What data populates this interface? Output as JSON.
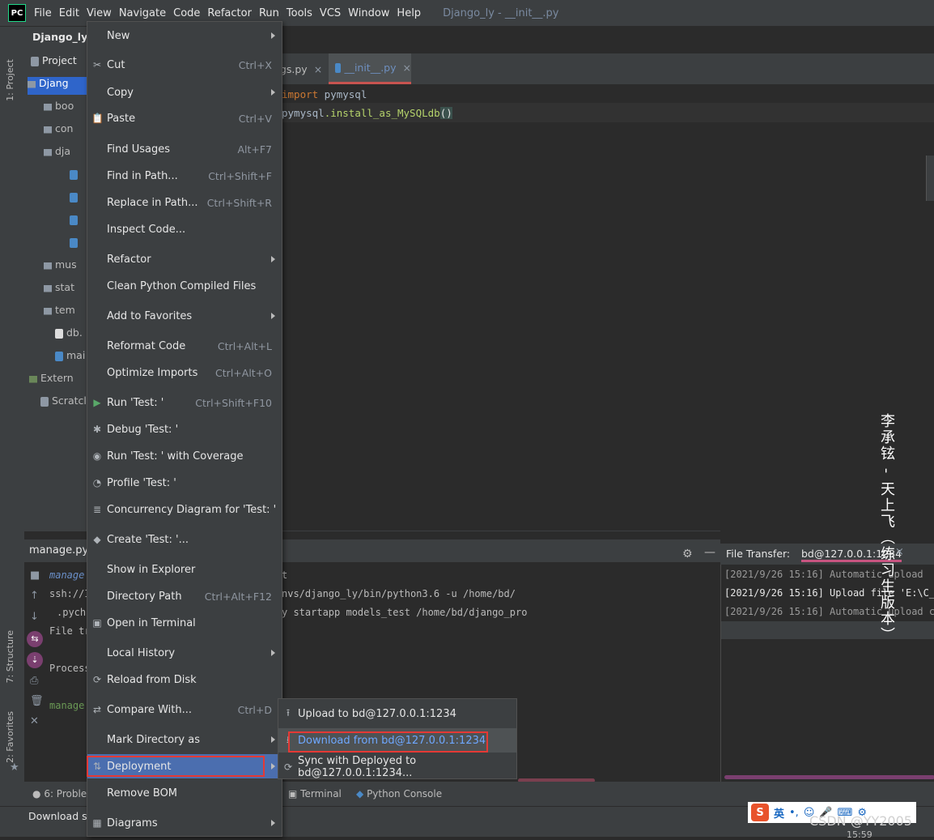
{
  "menubar": {
    "logo": "PC",
    "items": [
      "File",
      "Edit",
      "View",
      "Navigate",
      "Code",
      "Refactor",
      "Run",
      "Tools",
      "VCS",
      "Window",
      "Help"
    ],
    "title": "Django_ly - __init__.py"
  },
  "project": {
    "root_label": "Django_ly",
    "tab_label": "Project",
    "stripe_tab": "1: Project",
    "tree": [
      "Djang",
      "boo",
      "con",
      "dja",
      "mus",
      "stat",
      "tem",
      "db.",
      "mai",
      "Extern",
      "Scratcl"
    ]
  },
  "editor": {
    "tabs": [
      "ngs.py",
      "__init__.py"
    ],
    "lines": [
      {
        "kw": "import",
        "rest": " pymysql"
      },
      {
        "obj": "pymysql",
        "fn": ".install_as_MySQLdb",
        "paren": "()"
      }
    ]
  },
  "run_panel": {
    "tab_label": "manage.py@",
    "lines": [
      "manage",
      "ssh://I",
      ".pycha",
      "File tr",
      "Process",
      "manage"
    ],
    "cmd_lines": [
      "t",
      "nvs/django_ly/bin/python3.6 -u /home/bd/",
      "y startapp models_test /home/bd/django_pro"
    ]
  },
  "transfer": {
    "label": "File Transfer:",
    "tab": "bd@127.0.0.1:1234",
    "logs": [
      "[2021/9/26 15:16] Automatic upload",
      "[2021/9/26 15:16] Upload file 'E:\\C_py",
      "[2021/9/26 15:16] Automatic upload cor"
    ]
  },
  "context_menu": {
    "items": [
      {
        "label": "New",
        "shortcut": "",
        "icon": "",
        "submenu": true
      },
      {
        "label": "Cut",
        "shortcut": "Ctrl+X",
        "icon": "scissors-icon",
        "submenu": false
      },
      {
        "label": "Copy",
        "shortcut": "",
        "icon": "",
        "submenu": true
      },
      {
        "label": "Paste",
        "shortcut": "Ctrl+V",
        "icon": "clipboard-icon",
        "submenu": false
      },
      {
        "label": "Find Usages",
        "shortcut": "Alt+F7",
        "icon": "",
        "submenu": false
      },
      {
        "label": "Find in Path...",
        "shortcut": "Ctrl+Shift+F",
        "icon": "",
        "submenu": false
      },
      {
        "label": "Replace in Path...",
        "shortcut": "Ctrl+Shift+R",
        "icon": "",
        "submenu": false
      },
      {
        "label": "Inspect Code...",
        "shortcut": "",
        "icon": "",
        "submenu": false
      },
      {
        "label": "Refactor",
        "shortcut": "",
        "icon": "",
        "submenu": true
      },
      {
        "label": "Clean Python Compiled Files",
        "shortcut": "",
        "icon": "",
        "submenu": false
      },
      {
        "label": "Add to Favorites",
        "shortcut": "",
        "icon": "",
        "submenu": true
      },
      {
        "label": "Reformat Code",
        "shortcut": "Ctrl+Alt+L",
        "icon": "",
        "submenu": false
      },
      {
        "label": "Optimize Imports",
        "shortcut": "Ctrl+Alt+O",
        "icon": "",
        "submenu": false
      },
      {
        "label": "Run 'Test: '",
        "shortcut": "Ctrl+Shift+F10",
        "icon": "run-icon",
        "submenu": false
      },
      {
        "label": "Debug 'Test: '",
        "shortcut": "",
        "icon": "bug-icon",
        "submenu": false
      },
      {
        "label": "Run 'Test: ' with Coverage",
        "shortcut": "",
        "icon": "coverage-icon",
        "submenu": false
      },
      {
        "label": "Profile 'Test: '",
        "shortcut": "",
        "icon": "profile-icon",
        "submenu": false
      },
      {
        "label": "Concurrency Diagram for 'Test: '",
        "shortcut": "",
        "icon": "concurrency-icon",
        "submenu": false
      },
      {
        "label": "Create 'Test: '...",
        "shortcut": "",
        "icon": "python-icon",
        "submenu": false
      },
      {
        "label": "Show in Explorer",
        "shortcut": "",
        "icon": "",
        "submenu": false
      },
      {
        "label": "Directory Path",
        "shortcut": "Ctrl+Alt+F12",
        "icon": "",
        "submenu": false
      },
      {
        "label": "Open in Terminal",
        "shortcut": "",
        "icon": "terminal-icon",
        "submenu": false
      },
      {
        "label": "Local History",
        "shortcut": "",
        "icon": "",
        "submenu": true
      },
      {
        "label": "Reload from Disk",
        "shortcut": "",
        "icon": "reload-icon",
        "submenu": false
      },
      {
        "label": "Compare With...",
        "shortcut": "Ctrl+D",
        "icon": "compare-icon",
        "submenu": false
      },
      {
        "label": "Mark Directory as",
        "shortcut": "",
        "icon": "",
        "submenu": true
      },
      {
        "label": "Deployment",
        "shortcut": "",
        "icon": "deployment-icon",
        "submenu": true,
        "selected": true
      },
      {
        "label": "Remove BOM",
        "shortcut": "",
        "icon": "",
        "submenu": false
      },
      {
        "label": "Diagrams",
        "shortcut": "",
        "icon": "diagrams-icon",
        "submenu": true
      }
    ]
  },
  "deployment_submenu": {
    "items": [
      {
        "label": "Upload to bd@127.0.0.1:1234",
        "icon": "upload-icon"
      },
      {
        "label": "Download from bd@127.0.0.1:1234",
        "icon": "download-icon",
        "highlighted": true
      },
      {
        "label": "Sync with Deployed to bd@127.0.0.1:1234...",
        "icon": "sync-icon"
      }
    ]
  },
  "bottom_tabs": {
    "problems": "6: Problems",
    "terminal": "Terminal",
    "python_console": "Python Console",
    "structure": "7: Structure",
    "favorites": "2: Favorites"
  },
  "status": {
    "text": "Download s",
    "clock": "15:59"
  },
  "overlays": {
    "watermark_vertical": "李承铉 - 天上飞（练习生版本）",
    "ime_label": "英",
    "csdn": "CSDN @YY2005"
  },
  "colors": {
    "menu_bg": "#3c3f41",
    "editor_bg": "#2b2b2b",
    "selection": "#4b6eaf",
    "highlight_box": "#e53935",
    "keyword": "#cc7832"
  }
}
